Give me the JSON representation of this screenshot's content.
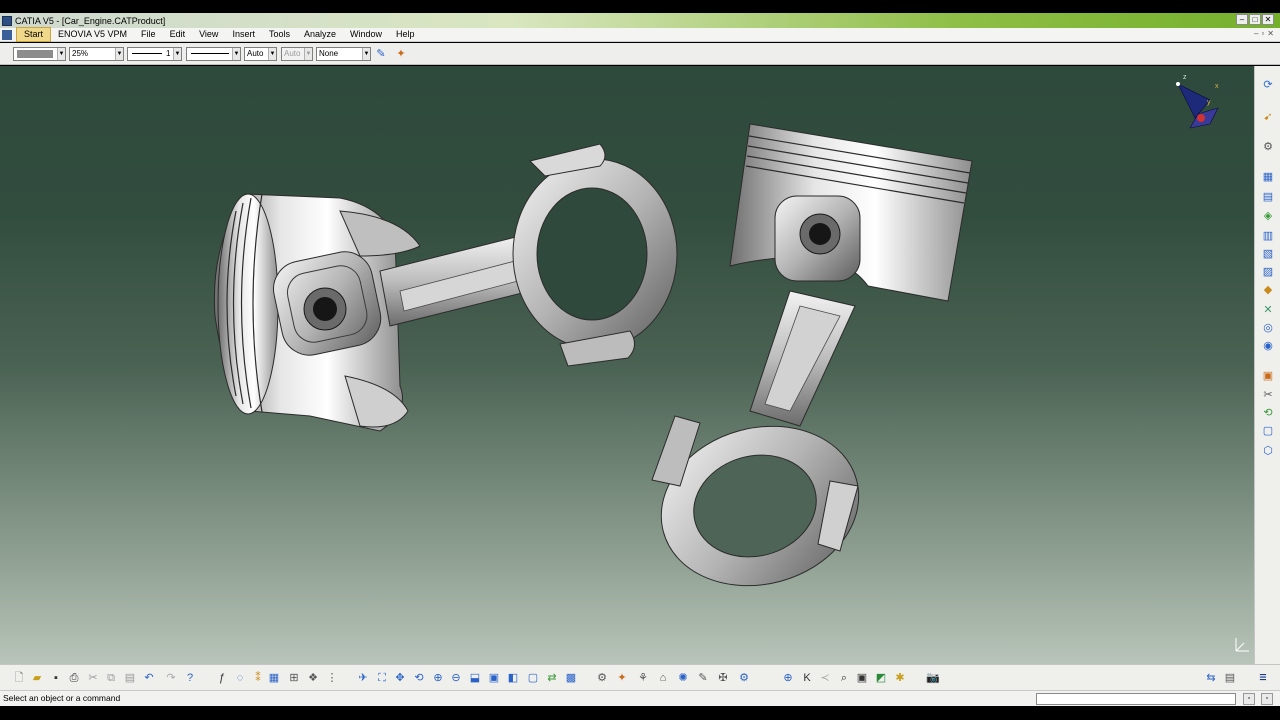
{
  "window": {
    "title": "CATIA V5 - [Car_Engine.CATProduct]",
    "controls": [
      "–",
      "□",
      "✕"
    ],
    "doc_controls": [
      "–",
      "▫",
      "✕"
    ]
  },
  "menu": {
    "items": [
      "Start",
      "ENOVIA V5 VPM",
      "File",
      "Edit",
      "View",
      "Insert",
      "Tools",
      "Analyze",
      "Window",
      "Help"
    ]
  },
  "properties": {
    "color": "",
    "transparency": "25%",
    "line_thickness": "1",
    "line_type": "",
    "point_symbol": "Auto",
    "rendering": "Auto",
    "layer": "None"
  },
  "status": {
    "message": "Select an object or a command",
    "command_value": ""
  },
  "colors": {
    "accent": "#74b02a",
    "viewport_top": "#2e4a3c",
    "viewport_bottom": "#b8c4b9",
    "part_metal": "#c9c9c9"
  },
  "icons": {
    "properties": [
      "painter-icon",
      "copy-format-icon"
    ],
    "right_toolbar": [
      "select-arrow-icon",
      "fly-mode-icon",
      "new-component-icon",
      "new-part-icon",
      "existing-component-icon",
      "replace-component-icon",
      "graph-tree-icon",
      "generate-numbering-icon",
      "reuse-pattern-icon",
      "multi-instantiate-icon",
      "constraint-coincidence-icon",
      "constraint-contact-icon",
      "constraint-offset-icon",
      "constraint-angle-icon",
      "fix-component-icon",
      "update-icon",
      "catalog-icon",
      "measure-icon",
      "sectioning-icon",
      "clash-icon"
    ],
    "bottom_toolbar": [
      "new-icon",
      "open-icon",
      "save-icon",
      "print-icon",
      "cut-icon",
      "copy-icon",
      "paste-icon",
      "undo-icon",
      "redo-icon",
      "whats-this-icon",
      "formula-icon",
      "comment-icon",
      "knowledge-icon",
      "table-icon",
      "tree-icon",
      "snap-icon",
      "scene-icon",
      "fly-icon",
      "fit-all-icon",
      "pan-icon",
      "rotate-icon",
      "zoom-in-icon",
      "zoom-out-icon",
      "normal-view-icon",
      "quick-view-icon",
      "view-mode-icon",
      "hide-show-icon",
      "swap-space-icon",
      "explode-icon",
      "manipulation-icon",
      "smart-move-icon",
      "snap-assembly-icon",
      "reset-icon",
      "sequence-icon",
      "product-icon",
      "compass-icon",
      "k-icon",
      "filter-icon",
      "search-icon",
      "material-icon",
      "light-icon",
      "capture-icon",
      "catia-logo-icon"
    ]
  }
}
